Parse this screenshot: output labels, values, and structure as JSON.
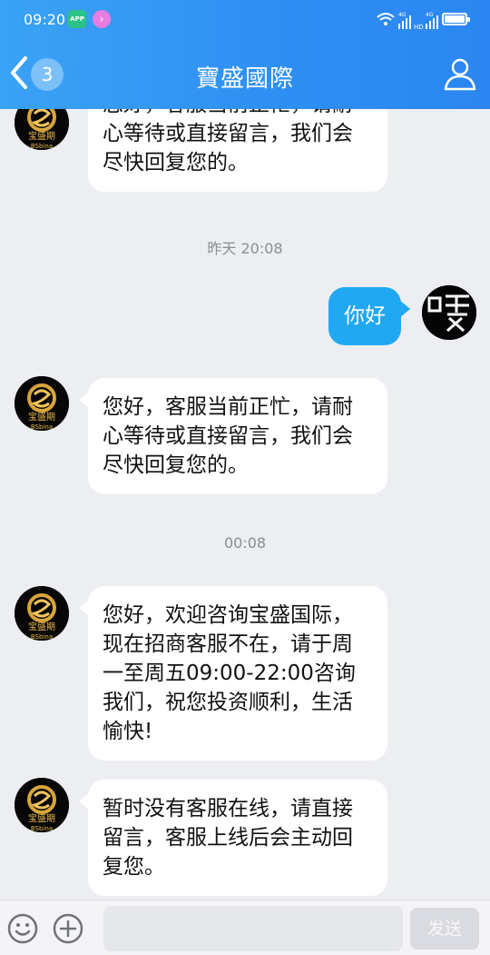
{
  "status_bar": {
    "time": "09:20",
    "app_icon_1": "app-icon-green",
    "app_icon_2": "app-icon-pink",
    "signal_label_1": "4G",
    "signal_label_2": "4G",
    "hd_label": "HD"
  },
  "header": {
    "back_icon": "chevron-left-icon",
    "unread_count": "3",
    "title": "寶盛國際",
    "profile_icon": "user-icon"
  },
  "messages": [
    {
      "side": "left",
      "avatar": "company-logo-avatar",
      "text": "您好，客服当前正忙，请耐心等待或直接留言，我们会尽快回复您的。"
    },
    {
      "timestamp": "昨天 20:08"
    },
    {
      "side": "right",
      "avatar": "user-avatar",
      "text": "你好"
    },
    {
      "side": "left",
      "avatar": "company-logo-avatar",
      "text": "您好，客服当前正忙，请耐心等待或直接留言，我们会尽快回复您的。"
    },
    {
      "timestamp": "00:08"
    },
    {
      "side": "left",
      "avatar": "company-logo-avatar",
      "text": "您好，欢迎咨询宝盛国际，现在招商客服不在，请于周一至周五09:00-22:00咨询我们，祝您投资顺利，生活愉快!"
    },
    {
      "side": "left",
      "avatar": "company-logo-avatar",
      "text": "暂时没有客服在线，请直接留言，客服上线后会主动回复您。"
    }
  ],
  "avatar_logo_text": {
    "line1": "宝盛期",
    "line2": "BSbina"
  },
  "input_bar": {
    "emoji_icon": "emoji-icon",
    "plus_icon": "plus-icon",
    "placeholder": "",
    "send_label": "发送"
  },
  "colors": {
    "header_start": "#3aa3f5",
    "header_end": "#2b86f1",
    "user_bubble": "#20a8f3",
    "chat_background": "#eceef2"
  }
}
